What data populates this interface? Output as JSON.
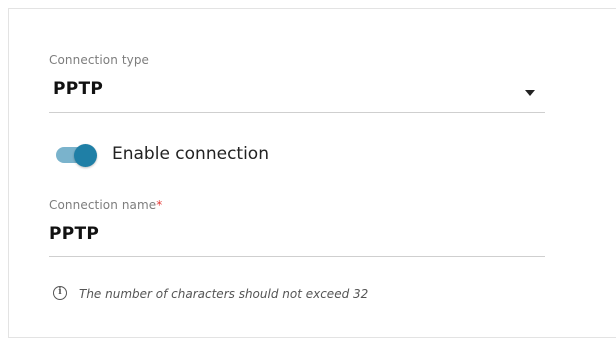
{
  "connection_type": {
    "label": "Connection type",
    "value": "PPTP",
    "icon": "chevron-down-icon"
  },
  "enable_connection": {
    "label": "Enable connection",
    "enabled": true,
    "accent_color": "#1f7fa6",
    "track_color": "#7ab3cc"
  },
  "connection_name": {
    "label": "Connection name",
    "required_marker": "*",
    "value": "PPTP",
    "hint": "The number of characters should not exceed 32",
    "hint_icon": "info-icon"
  },
  "colors": {
    "required": "#e53935",
    "label": "#7d7d7d",
    "text": "#111111"
  }
}
